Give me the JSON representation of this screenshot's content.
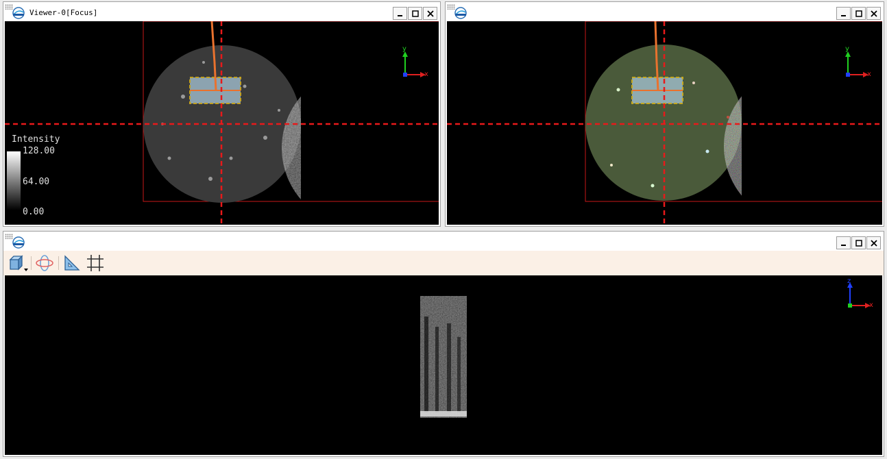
{
  "viewers": [
    {
      "title": "Viewer-0[Focus]"
    },
    {
      "title": ""
    },
    {
      "title": ""
    }
  ],
  "window_buttons": {
    "minimize": "minimize",
    "maximize": "maximize",
    "close": "close"
  },
  "legend": {
    "title": "Intensity",
    "max": "128.00",
    "mid": "64.00",
    "min": "0.00"
  },
  "axes": {
    "top": {
      "vertical": "y",
      "horizontal": "x"
    },
    "bottom": {
      "vertical": "z",
      "horizontal": "x"
    }
  },
  "toolbar": {
    "tools": [
      "view-cube-icon",
      "orbit-icon",
      "ruler-icon",
      "grid-icon"
    ]
  },
  "colors": {
    "crosshair": "#e8191a",
    "selection_border": "#f0c419",
    "trajectory": "#e9722e",
    "bounds": "#d01818",
    "axis_x": "#e02020",
    "axis_y": "#20d020",
    "axis_z": "#2040ff",
    "toolbar_bg": "#fbf0e6"
  }
}
